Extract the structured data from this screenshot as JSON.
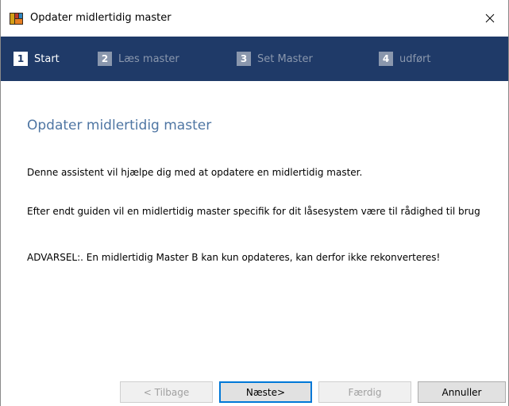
{
  "window": {
    "title": "Opdater midlertidig master"
  },
  "steps": [
    {
      "number": "1",
      "label": "Start",
      "active": true
    },
    {
      "number": "2",
      "label": "Læs master",
      "active": false
    },
    {
      "number": "3",
      "label": "Set Master",
      "active": false
    },
    {
      "number": "4",
      "label": "udført",
      "active": false
    }
  ],
  "content": {
    "heading": "Opdater midlertidig master",
    "paragraph1": "Denne assistent vil hjælpe dig med at opdatere en midlertidig master.",
    "paragraph2": "Efter endt guiden vil en midlertidig master specifik for dit låsesystem være til rådighed til brug",
    "paragraph3": "ADVARSEL:. En midlertidig Master B kan kun opdateres, kan derfor ikke rekonverteres!"
  },
  "buttons": {
    "back": "< Tilbage",
    "next": "Næste>",
    "finish": "Færdig",
    "cancel": "Annuller"
  },
  "colors": {
    "steps_bar": "#1f3a68",
    "heading": "#4f76a3",
    "inactive_step": "#8a97ad"
  },
  "icons": {
    "app": "app-icon",
    "close": "close-icon"
  }
}
